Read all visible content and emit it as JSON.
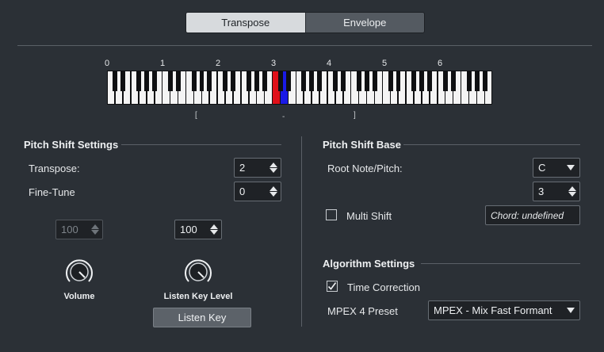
{
  "tabs": [
    {
      "label": "Transpose",
      "active": true
    },
    {
      "label": "Envelope",
      "active": false
    }
  ],
  "keyboard": {
    "octave_labels": [
      "0",
      "1",
      "2",
      "3",
      "4",
      "5",
      "6"
    ],
    "range_marks": [
      "[",
      "-",
      "]"
    ],
    "highlight_colors": {
      "red": "#e0101a",
      "blue": "#1a1ae6"
    }
  },
  "pitch_shift_settings": {
    "title": "Pitch Shift Settings",
    "transpose": {
      "label": "Transpose:",
      "value": "2"
    },
    "fine_tune": {
      "label": "Fine-Tune",
      "value": "0"
    },
    "volume_value": "100",
    "listen_level_value": "100",
    "volume_label": "Volume",
    "listen_key_level_label": "Listen Key Level",
    "listen_key_button": "Listen Key"
  },
  "pitch_shift_base": {
    "title": "Pitch Shift Base",
    "root_note_label": "Root Note/Pitch:",
    "root_note_value": "C",
    "octave_value": "3",
    "multi_shift_label": "Multi Shift",
    "multi_shift_checked": false,
    "chord_value": "Chord: undefined"
  },
  "algorithm_settings": {
    "title": "Algorithm Settings",
    "time_correction_label": "Time Correction",
    "time_correction_checked": true,
    "mpex_label": "MPEX 4 Preset",
    "mpex_value": "MPEX - Mix Fast Formant"
  },
  "colors": {
    "background": "#2b3036",
    "field_bg": "#1f2226",
    "tab_active": "#d7dadd"
  }
}
